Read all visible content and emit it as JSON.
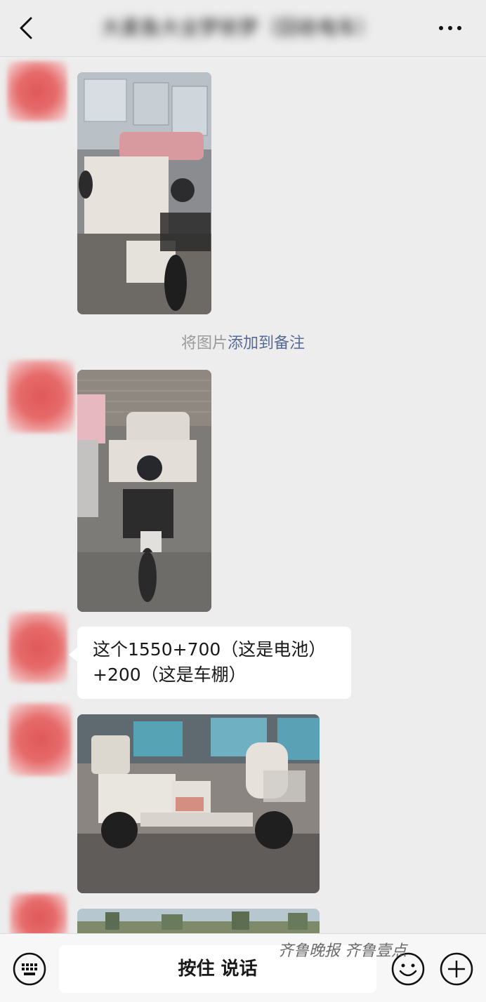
{
  "header": {
    "title": "大麦鱼大全梦依梦（回收电车）",
    "back_icon": "chevron-left-icon",
    "more_icon": "ellipsis-icon"
  },
  "system_note": {
    "prefix": "将图片",
    "link": "添加到备注"
  },
  "messages": {
    "text_bubble": {
      "line1": "这个1550+700（这是电池）",
      "line2": "+200（这是车棚）"
    }
  },
  "input_bar": {
    "hold_to_talk": "按住 说话",
    "keyboard_icon": "keyboard-icon",
    "emoji_icon": "emoji-icon",
    "plus_icon": "plus-icon"
  },
  "watermark": {
    "text": "齐鲁晚报 齐鲁壹点"
  },
  "colors": {
    "background": "#ededed",
    "link": "#576b95",
    "bubble": "#ffffff"
  }
}
